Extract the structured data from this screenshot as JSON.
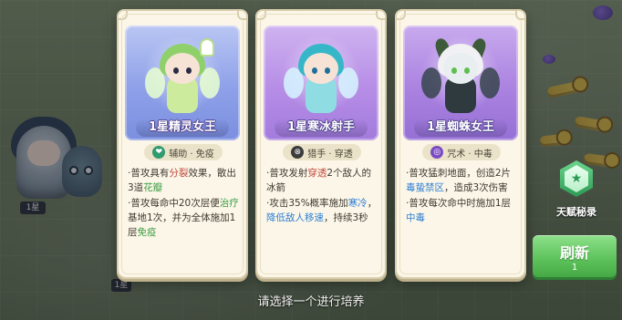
{
  "scene": {
    "hero_level": "1星",
    "bottom_counter": "1星"
  },
  "cards": [
    {
      "name": "1星精灵女王",
      "role": "辅助 · 免疫",
      "role_icon": "heart-icon",
      "theme": "#8ea0e8",
      "desc": [
        [
          {
            "t": "·普攻具有"
          },
          {
            "t": "分裂",
            "c": "red"
          },
          {
            "t": "效果，散出3道"
          },
          {
            "t": "花瓣",
            "c": "green"
          }
        ],
        [
          {
            "t": "·普攻每命中20次层便"
          },
          {
            "t": "治疗",
            "c": "green"
          },
          {
            "t": "基地1次，并为全体施加1层"
          },
          {
            "t": "免疫",
            "c": "green"
          }
        ]
      ]
    },
    {
      "name": "1星寒冰射手",
      "role": "猎手 · 穿透",
      "role_icon": "crosshair-icon",
      "theme": "#b68de6",
      "desc": [
        [
          {
            "t": "·普攻发射"
          },
          {
            "t": "穿透",
            "c": "red"
          },
          {
            "t": "2个敌人的冰箭"
          }
        ],
        [
          {
            "t": "·攻击35%概率施加"
          },
          {
            "t": "寒冷",
            "c": "blue"
          },
          {
            "t": "，"
          },
          {
            "t": "降低敌人移速",
            "c": "blue"
          },
          {
            "t": "，持续3秒"
          }
        ]
      ]
    },
    {
      "name": "1星蜘蛛女王",
      "role": "咒术 · 中毒",
      "role_icon": "spiral-icon",
      "theme": "#aa82e0",
      "desc": [
        [
          {
            "t": "·普攻猛刺地面，创造2片"
          },
          {
            "t": "毒蛰禁区",
            "c": "blue"
          },
          {
            "t": "，造成3次伤害"
          }
        ],
        [
          {
            "t": "·普攻每次命中时施加1层"
          },
          {
            "t": "中毒",
            "c": "blue"
          }
        ]
      ]
    }
  ],
  "talent": {
    "label": "天赋秘录",
    "icon": "star-hex-icon"
  },
  "refresh": {
    "label": "刷新",
    "count": "1"
  },
  "prompt": "请选择一个进行培养",
  "colors": {
    "green": "#3b9c44",
    "blue": "#2e7fd6",
    "red": "#c0443c"
  }
}
